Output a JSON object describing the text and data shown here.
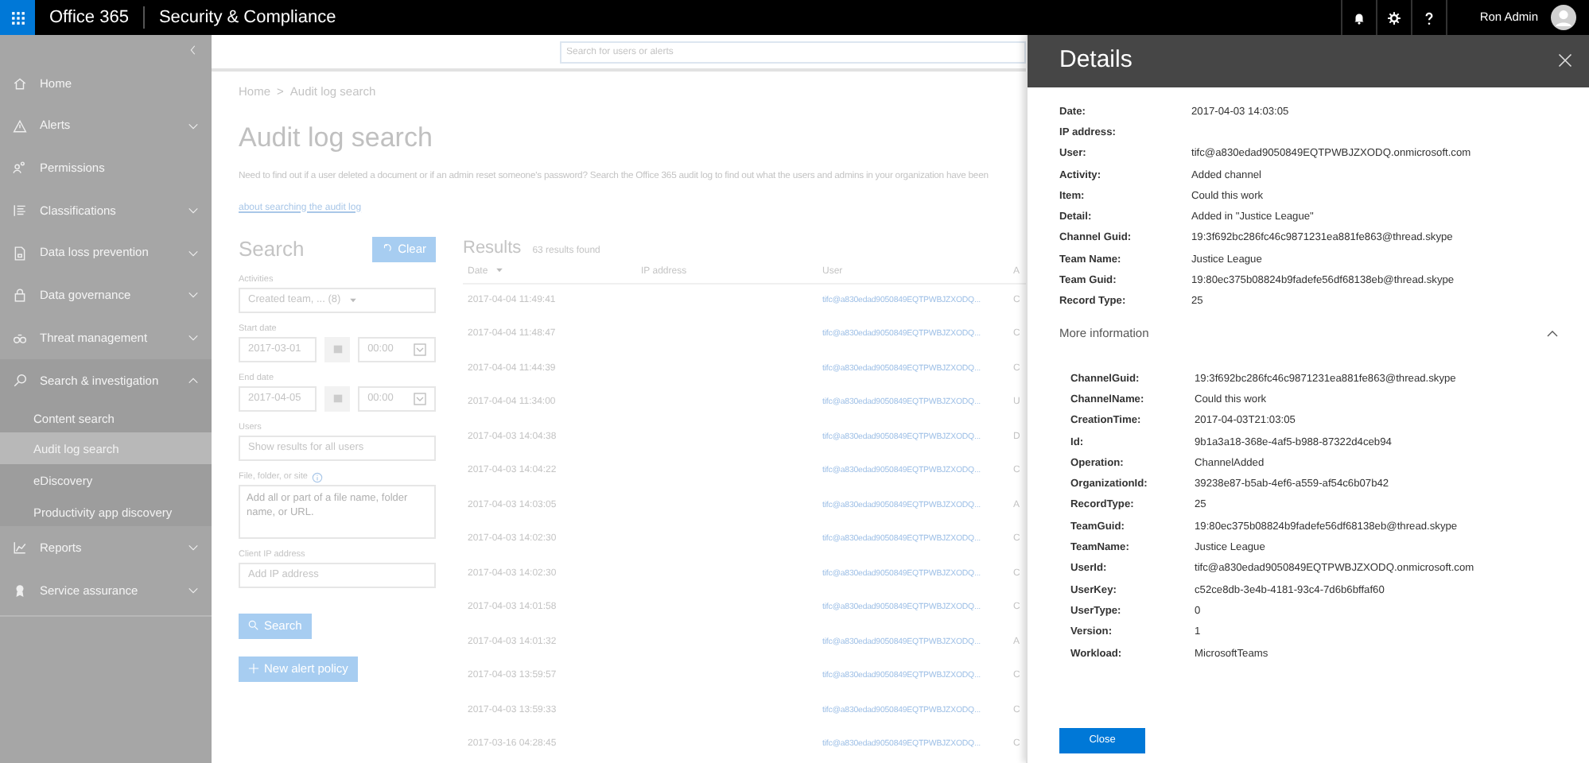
{
  "topbar": {
    "app_name": "Office 365",
    "product": "Security & Compliance",
    "user_name": "Ron Admin"
  },
  "search_bar": {
    "placeholder": "Search for users or alerts"
  },
  "nav": {
    "items": [
      {
        "label": "Home",
        "kind": "link"
      },
      {
        "label": "Alerts",
        "kind": "group",
        "expanded": false
      },
      {
        "label": "Permissions",
        "kind": "link"
      },
      {
        "label": "Classifications",
        "kind": "group",
        "expanded": false
      },
      {
        "label": "Data loss prevention",
        "kind": "group",
        "expanded": false
      },
      {
        "label": "Data governance",
        "kind": "group",
        "expanded": false
      },
      {
        "label": "Threat management",
        "kind": "group",
        "expanded": false
      },
      {
        "label": "Search & investigation",
        "kind": "group",
        "expanded": true,
        "children": [
          {
            "label": "Content search",
            "selected": false
          },
          {
            "label": "Audit log search",
            "selected": true
          },
          {
            "label": "eDiscovery",
            "selected": false
          },
          {
            "label": "Productivity app discovery",
            "selected": false
          }
        ]
      },
      {
        "label": "Reports",
        "kind": "group",
        "expanded": false
      },
      {
        "label": "Service assurance",
        "kind": "group",
        "expanded": false
      }
    ]
  },
  "breadcrumb": {
    "home": "Home",
    "separator": ">",
    "current": "Audit log search"
  },
  "title": "Audit log search",
  "description": "Need to find out if a user deleted a document or if an admin reset someone's password? Search the Office 365 audit log to find out what the users and admins in your organization have been",
  "description_link": "about searching the audit log",
  "search": {
    "heading": "Search",
    "clear_button": "Clear",
    "activities": {
      "label": "Activities",
      "value": "Created team, ... (8)"
    },
    "start_date": {
      "label": "Start date",
      "date": "2017-03-01",
      "time": "00:00"
    },
    "end_date": {
      "label": "End date",
      "date": "2017-04-05",
      "time": "00:00"
    },
    "users": {
      "label": "Users",
      "placeholder": "Show results for all users"
    },
    "file": {
      "label": "File, folder, or site",
      "placeholder": "Add all or part of a file name, folder name, or URL."
    },
    "ip": {
      "label": "Client IP address",
      "placeholder": "Add IP address"
    },
    "search_button": "Search",
    "alert_button": "New alert policy"
  },
  "results": {
    "heading": "Results",
    "count": "63 results found",
    "columns": [
      "Date",
      "IP address",
      "User",
      "A"
    ],
    "rows": [
      {
        "date": "2017-04-04 11:49:41",
        "user": "tifc@a830edad9050849EQTPWBJZXODQ...",
        "column_4": "C"
      },
      {
        "date": "2017-04-04 11:48:47",
        "user": "tifc@a830edad9050849EQTPWBJZXODQ...",
        "column_4": "C"
      },
      {
        "date": "2017-04-04 11:44:39",
        "user": "tifc@a830edad9050849EQTPWBJZXODQ...",
        "column_4": "C"
      },
      {
        "date": "2017-04-04 11:34:00",
        "user": "tifc@a830edad9050849EQTPWBJZXODQ...",
        "column_4": "U"
      },
      {
        "date": "2017-04-03 14:04:38",
        "user": "tifc@a830edad9050849EQTPWBJZXODQ...",
        "column_4": "D"
      },
      {
        "date": "2017-04-03 14:04:22",
        "user": "tifc@a830edad9050849EQTPWBJZXODQ...",
        "column_4": "C"
      },
      {
        "date": "2017-04-03 14:03:05",
        "user": "tifc@a830edad9050849EQTPWBJZXODQ...",
        "column_4": "A"
      },
      {
        "date": "2017-04-03 14:02:30",
        "user": "tifc@a830edad9050849EQTPWBJZXODQ...",
        "column_4": "C"
      },
      {
        "date": "2017-04-03 14:02:30",
        "user": "tifc@a830edad9050849EQTPWBJZXODQ...",
        "column_4": "C"
      },
      {
        "date": "2017-04-03 14:01:58",
        "user": "tifc@a830edad9050849EQTPWBJZXODQ...",
        "column_4": "C"
      },
      {
        "date": "2017-04-03 14:01:32",
        "user": "tifc@a830edad9050849EQTPWBJZXODQ...",
        "column_4": "A"
      },
      {
        "date": "2017-04-03 13:59:57",
        "user": "tifc@a830edad9050849EQTPWBJZXODQ...",
        "column_4": "C"
      },
      {
        "date": "2017-04-03 13:59:33",
        "user": "tifc@a830edad9050849EQTPWBJZXODQ...",
        "column_4": "C"
      },
      {
        "date": "2017-03-16 04:28:45",
        "user": "tifc@a830edad9050849EQTPWBJZXODQ...",
        "column_4": "C"
      }
    ]
  },
  "details": {
    "title": "Details",
    "fields": [
      {
        "label": "Date:",
        "value": "2017-04-03 14:03:05"
      },
      {
        "label": "IP address:"
      },
      {
        "label": "User:",
        "value": "tifc@a830edad9050849EQTPWBJZXODQ.onmicrosoft.com"
      },
      {
        "label": "Activity:",
        "value": "Added channel"
      },
      {
        "label": "Item:",
        "value": "Could this work"
      },
      {
        "label": "Detail:",
        "value": "Added in \"Justice League\""
      },
      {
        "label": "Channel Guid:",
        "value": "19:3f692bc286fc46c9871231ea881fe863@thread.skype"
      },
      {
        "label": "Team Name:",
        "value": "Justice League"
      },
      {
        "label": "Team Guid:",
        "value": "19:80ec375b08824b9fadefe56df68138eb@thread.skype"
      },
      {
        "label": "Record Type:",
        "value": "25"
      }
    ],
    "more_info": {
      "label": "More information",
      "expanded": true,
      "fields": [
        {
          "label": "ChannelGuid:",
          "value": "19:3f692bc286fc46c9871231ea881fe863@thread.skype"
        },
        {
          "label": "ChannelName:",
          "value": "Could this work"
        },
        {
          "label": "CreationTime:",
          "value": "2017-04-03T21:03:05"
        },
        {
          "label": "Id:",
          "value": "9b1a3a18-368e-4af5-b988-87322d4ceb94"
        },
        {
          "label": "Operation:",
          "value": "ChannelAdded"
        },
        {
          "label": "OrganizationId:",
          "value": "39238e87-b5ab-4ef6-a559-af54c6b07b42"
        },
        {
          "label": "RecordType:",
          "value": "25"
        },
        {
          "label": "TeamGuid:",
          "value": "19:80ec375b08824b9fadefe56df68138eb@thread.skype"
        },
        {
          "label": "TeamName:",
          "value": "Justice League"
        },
        {
          "label": "UserId:",
          "value": "tifc@a830edad9050849EQTPWBJZXODQ.onmicrosoft.com"
        },
        {
          "label": "UserKey:",
          "value": "c52ce8db-3e4b-4181-93c4-7d6b6bffaf60"
        },
        {
          "label": "UserType:",
          "value": "0"
        },
        {
          "label": "Version:",
          "value": "1"
        },
        {
          "label": "Workload:",
          "value": "MicrosoftTeams"
        }
      ]
    },
    "close_button": "Close"
  }
}
